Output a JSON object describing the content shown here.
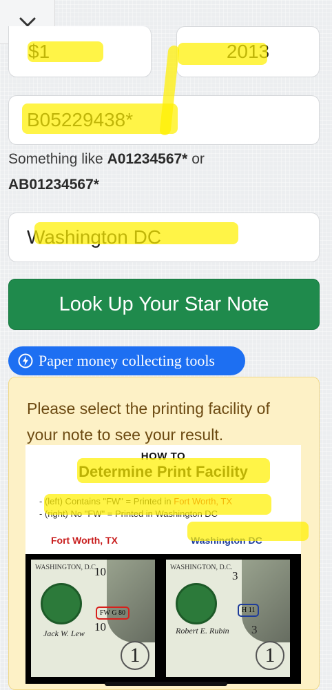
{
  "form": {
    "denomination_value": "$1",
    "series_year_value": "2013",
    "serial_value": "B05229438*",
    "serial_hint_prefix": "Something like ",
    "serial_hint_example1": "A01234567*",
    "serial_hint_middle": " or",
    "serial_hint_example2": "AB01234567*",
    "facility_value": "Washington DC",
    "lookup_label": "Look Up Your Star Note"
  },
  "tools_label": "Paper money collecting tools",
  "notice": {
    "text": "Please select the printing facility of your note to see your result."
  },
  "figure": {
    "howto": "HOW TO",
    "title": "Determine Print Facility",
    "line1_prefix": "- (left) Contains \"FW\" = Printed in ",
    "line1_place": "Fort Worth, TX",
    "line2": "- (right) No \"FW\" = Printed in Washington DC",
    "label_fw": "Fort Worth, TX",
    "label_dc": "Washington DC",
    "left_bill": {
      "bank": "WASHINGTON, D.C.",
      "number": "10",
      "mark": "FW G 80",
      "signature": "Jack W. Lew",
      "one": "1"
    },
    "right_bill": {
      "bank": "WASHINGTON, D.C.",
      "number": "3",
      "mark": "H 11",
      "signature": "Robert E. Rubin",
      "one": "1"
    }
  },
  "colors": {
    "lookup_green": "#1f8a4c",
    "tools_blue": "#1d6ff2",
    "notice_bg": "#fdf1c6",
    "highlight": "#fff000"
  }
}
